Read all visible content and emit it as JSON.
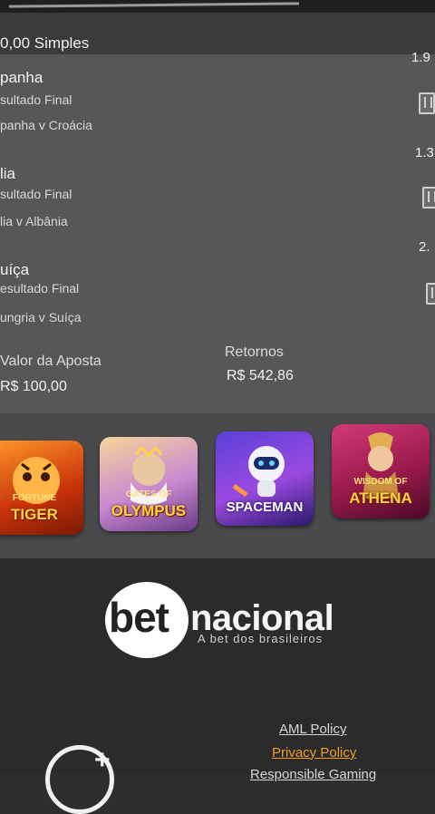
{
  "header": {
    "title": "0,00 Simples"
  },
  "selections": [
    {
      "name": "panha",
      "market": "sultado Final",
      "match": "panha v Croácia",
      "odd": "1.9"
    },
    {
      "name": "lia",
      "market": "sultado Final",
      "match": "lia v Albânia",
      "odd": "1.3"
    },
    {
      "name": "uíça",
      "market": "esultado Final",
      "match": "ungria v Suíça",
      "odd": "2."
    }
  ],
  "stake": {
    "label": "Valor da Aposta",
    "value": "R$ 100,00"
  },
  "returns": {
    "label": "Retornos",
    "value": "R$ 542,86"
  },
  "games": [
    {
      "title": "TIGER",
      "subtitle": "FORTUNE",
      "icon": "fortune-tiger-icon"
    },
    {
      "title": "OLYMPUS",
      "subtitle": "GATES OF",
      "icon": "gates-of-olympus-icon"
    },
    {
      "title": "SPACEMAN",
      "subtitle": "",
      "icon": "spaceman-icon"
    },
    {
      "title": "ATHENA",
      "subtitle": "WISDOM OF",
      "icon": "wisdom-of-athena-icon"
    }
  ],
  "footer": {
    "logo_bet": "bet",
    "logo_nacional": "nacional",
    "tagline": "A bet dos brasileiros",
    "links": [
      "AML Policy",
      "Privacy Policy",
      "Responsible Gaming"
    ]
  },
  "colors": {
    "accent_link": "#f0a020",
    "slip_bg": "#57575a",
    "header_bg": "#3b3b3d"
  }
}
